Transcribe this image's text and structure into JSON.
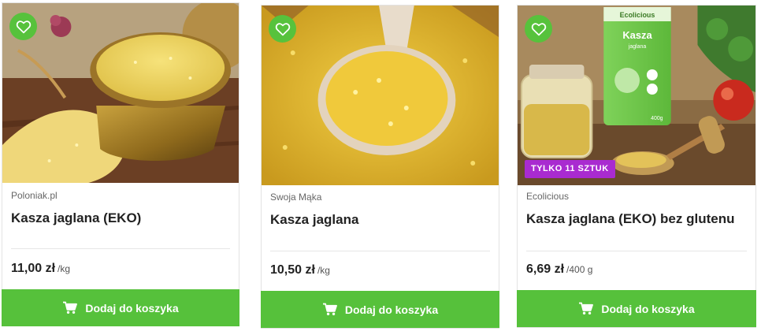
{
  "theme": {
    "accent": "#56c13b",
    "badge_color": "#a92bd0"
  },
  "products": [
    {
      "brand": "Poloniak.pl",
      "name": "Kasza jaglana (EKO)",
      "price": "11,00 zł",
      "unit": "/kg",
      "cart_label": "Dodaj do koszyka",
      "favorite_icon": "heart-outline-icon",
      "cart_icon": "cart-icon"
    },
    {
      "brand": "Swoja Mąka",
      "name": "Kasza jaglana",
      "price": "10,50 zł",
      "unit": "/kg",
      "cart_label": "Dodaj do koszyka",
      "favorite_icon": "heart-outline-icon",
      "cart_icon": "cart-icon"
    },
    {
      "brand": "Ecolicious",
      "name": "Kasza jaglana (EKO) bez glutenu",
      "price": "6,69 zł",
      "unit": "/400 g",
      "badge": "TYLKO 11 SZTUK",
      "package_brand": "Ecolicious",
      "package_title": "Kasza",
      "package_subtitle": "jaglana",
      "package_weight": "400g",
      "cart_label": "Dodaj do koszyka",
      "favorite_icon": "heart-outline-icon",
      "cart_icon": "cart-icon"
    }
  ]
}
